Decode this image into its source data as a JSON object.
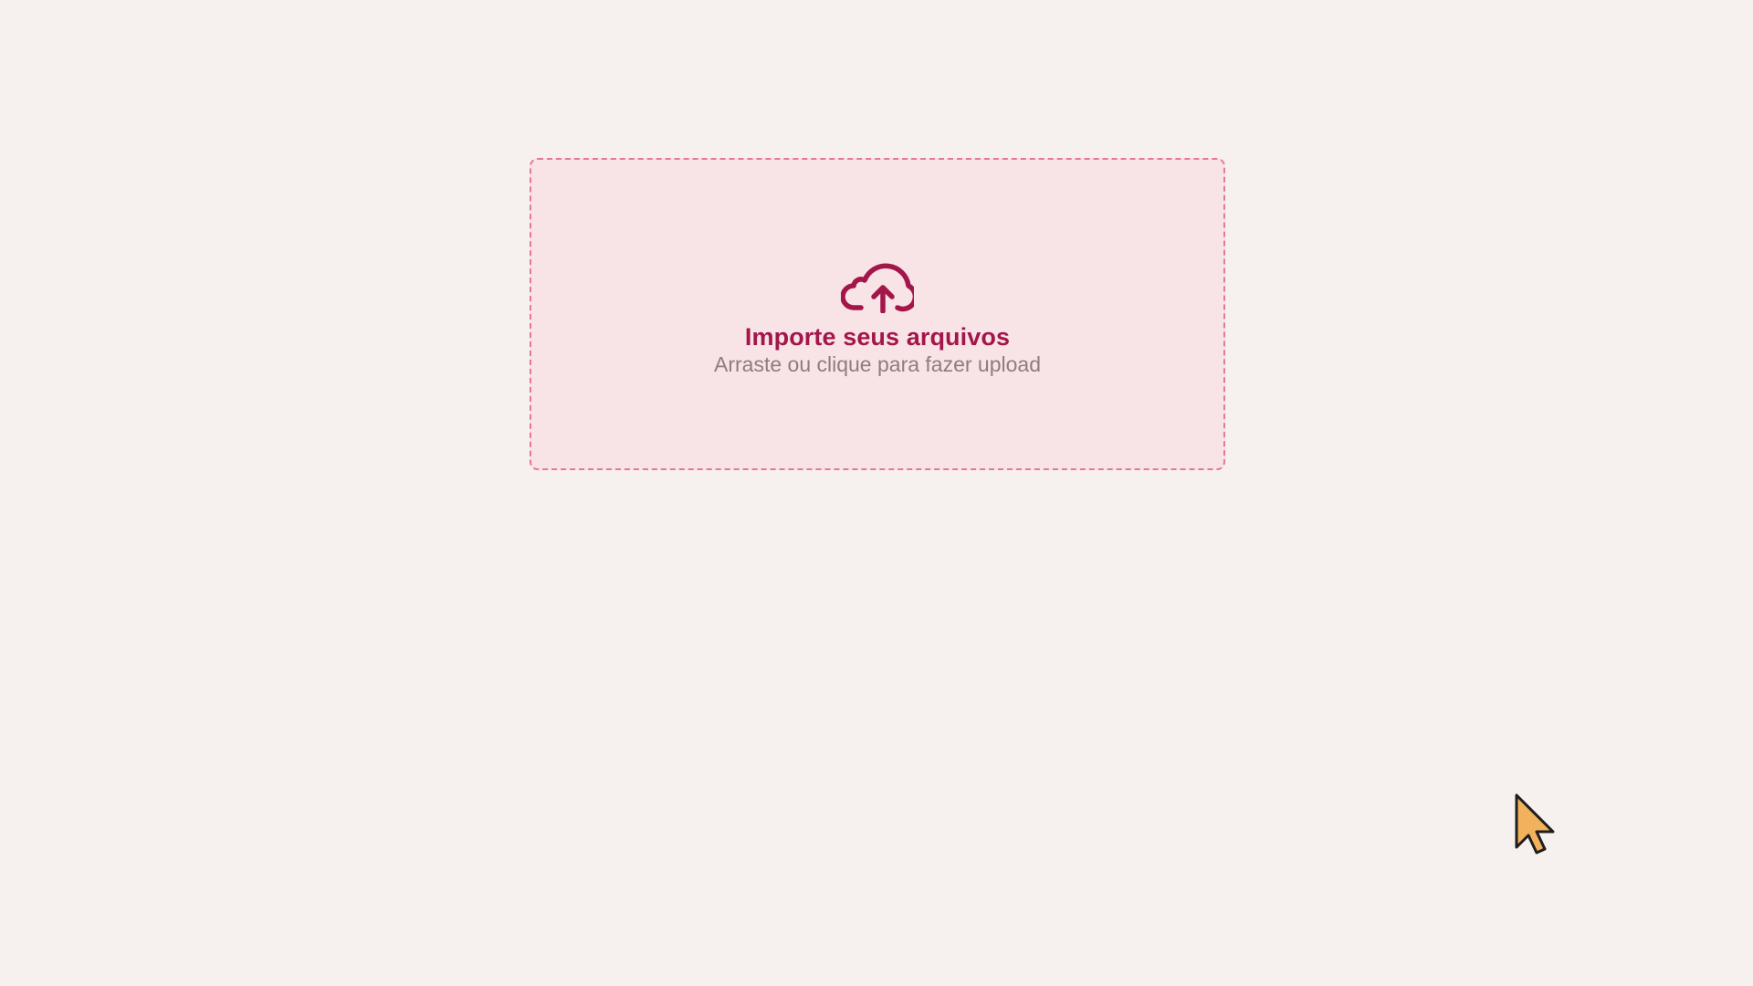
{
  "dropzone": {
    "icon": "cloud-upload-icon",
    "title": "Importe seus arquivos",
    "subtitle": "Arraste ou clique para fazer upload"
  },
  "colors": {
    "background": "#f6f1ef",
    "dropzone_fill": "#f8e3e7",
    "dropzone_border": "#e5769e",
    "accent": "#a3164a",
    "subtitle": "#8e7d80",
    "cursor": "#f2b15c"
  },
  "cursor": {
    "icon": "mouse-pointer-icon"
  }
}
